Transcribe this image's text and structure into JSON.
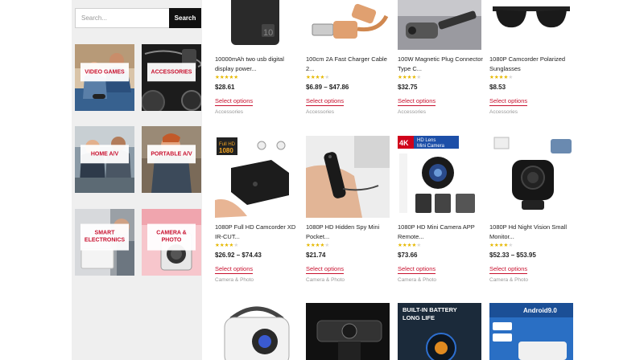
{
  "search": {
    "placeholder": "Search...",
    "button_label": "Search"
  },
  "categories": [
    {
      "label": "VIDEO GAMES"
    },
    {
      "label": "ACCESSORIES"
    },
    {
      "label": "HOME A/V"
    },
    {
      "label": "PORTABLE A/V"
    },
    {
      "label": "SMART ELECTRONICS"
    },
    {
      "label": "CAMERA & PHOTO"
    }
  ],
  "products": [
    {
      "title": "10000mAh two usb digital display power...",
      "price": "$28.61",
      "rating": 5,
      "action": "Select options",
      "category": "Accessories",
      "icon": "power-bank-icon"
    },
    {
      "title": "100cm 2A Fast Charger Cable 2...",
      "price": "$6.89 – $47.86",
      "rating": 4,
      "action": "Select options",
      "category": "Accessories",
      "icon": "usb-cable-icon"
    },
    {
      "title": "100W Magnetic Plug Connector Type C...",
      "price": "$32.75",
      "rating": 4,
      "action": "Select options",
      "category": "Accessories",
      "icon": "magnetic-plug-icon"
    },
    {
      "title": "1080P Camcorder Polarized Sunglasses",
      "price": "$8.53",
      "rating": 4,
      "action": "Select options",
      "category": "Accessories",
      "icon": "sunglasses-icon"
    },
    {
      "title": "1080P Full HD Camcorder XD IR-CUT...",
      "price": "$26.92 – $74.43",
      "rating": 4,
      "action": "Select options",
      "category": "Camera & Photo",
      "icon": "mini-camcorder-icon",
      "badge": "Full HD 1080"
    },
    {
      "title": "1080P HD Hidden Spy Mini Pocket...",
      "price": "$21.74",
      "rating": 4,
      "action": "Select options",
      "category": "Camera & Photo",
      "icon": "pocket-camera-icon"
    },
    {
      "title": "1080P HD Mini Camera APP Remote...",
      "price": "$73.66",
      "rating": 4,
      "action": "Select options",
      "category": "Camera & Photo",
      "icon": "mini-camera-app-icon",
      "badge": "4K HD Lens Mini Camera"
    },
    {
      "title": "1080P Hd Night Vision Small Monitor...",
      "price": "$52.33 – $53.95",
      "rating": 4,
      "action": "Select options",
      "category": "Camera & Photo",
      "icon": "night-vision-camera-icon"
    },
    {
      "title": "",
      "icon": "projector-icon"
    },
    {
      "title": "",
      "icon": "webcam-icon"
    },
    {
      "title": "",
      "icon": "battery-camera-icon",
      "badge": "BUILT-IN BATTERY LONG LIFE"
    },
    {
      "title": "",
      "icon": "android-projector-icon",
      "badge": "Android9.0"
    }
  ],
  "colors": {
    "accent": "#c8102e",
    "star": "#e6b800",
    "sidebar_bg": "#efefef"
  }
}
